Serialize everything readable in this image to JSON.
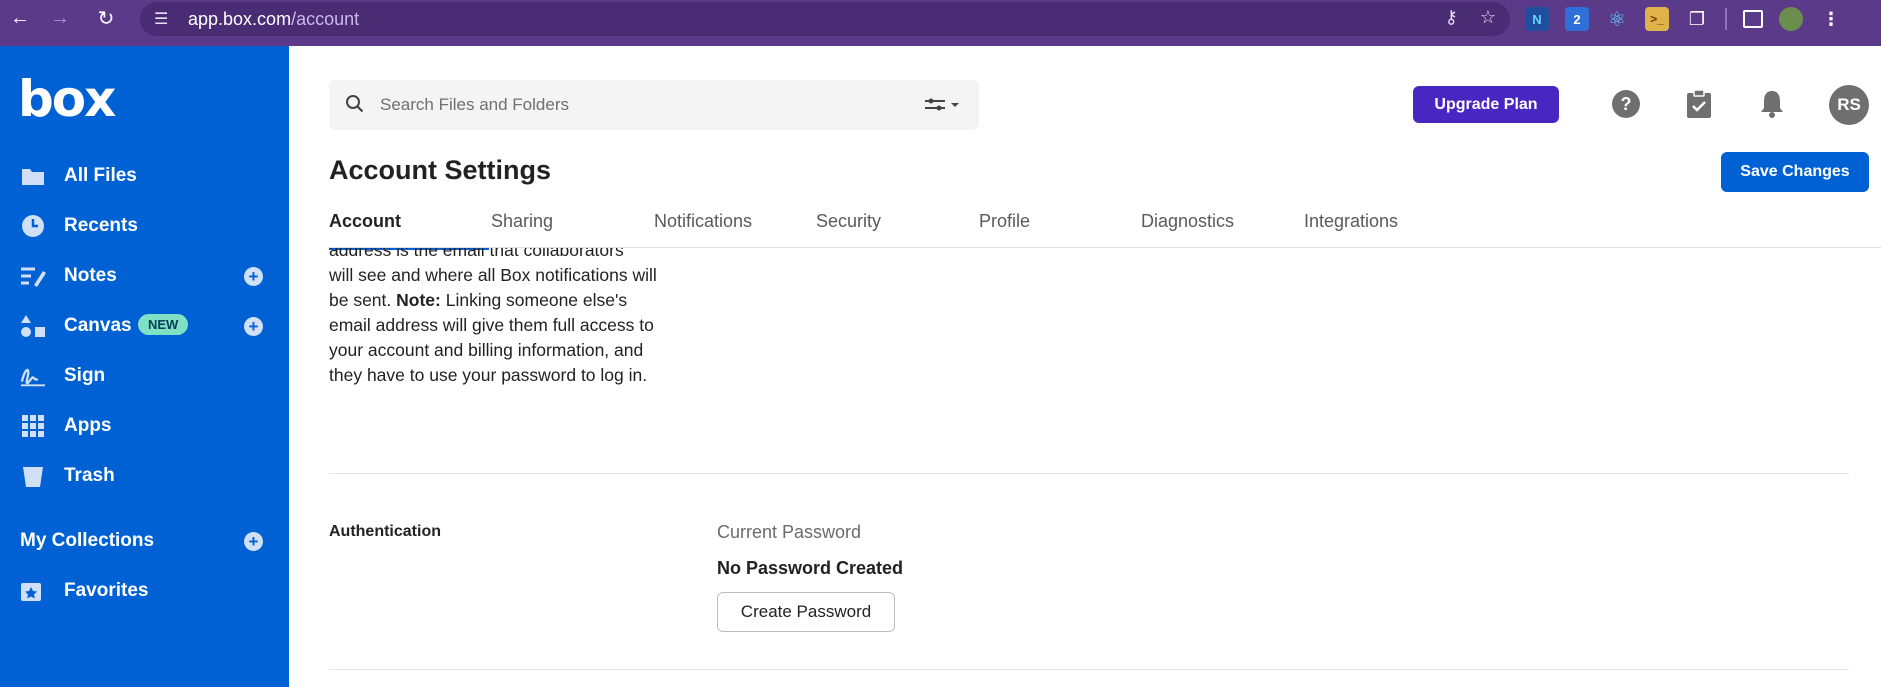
{
  "browser": {
    "url_host": "app.box.com",
    "url_path": "/account"
  },
  "sidebar": {
    "logo": "box",
    "items": [
      {
        "label": "All Files"
      },
      {
        "label": "Recents"
      },
      {
        "label": "Notes"
      },
      {
        "label": "Canvas",
        "badge": "NEW"
      },
      {
        "label": "Sign"
      },
      {
        "label": "Apps"
      },
      {
        "label": "Trash"
      },
      {
        "label": "My Collections"
      },
      {
        "label": "Favorites"
      }
    ]
  },
  "header": {
    "search_placeholder": "Search Files and Folders",
    "upgrade_label": "Upgrade Plan",
    "avatar_initials": "RS"
  },
  "page": {
    "title": "Account Settings",
    "save_label": "Save Changes",
    "tabs": [
      "Account",
      "Sharing",
      "Notifications",
      "Security",
      "Profile",
      "Diagnostics",
      "Integrations"
    ]
  },
  "content": {
    "para_top": "address is the email that collaborators",
    "para_1": "will see and where all Box notifications will be sent. ",
    "para_note": "Note:",
    "para_2": " Linking someone else's email address will give them full access to your account and billing information, and they have to use your password to log in.",
    "auth_label": "Authentication",
    "current_password_label": "Current Password",
    "current_password_value": "No Password Created",
    "create_password_label": "Create Password"
  },
  "colors": {
    "sidebar": "#0061d5",
    "upgrade": "#4826c2",
    "browser": "#5b3a8a"
  }
}
